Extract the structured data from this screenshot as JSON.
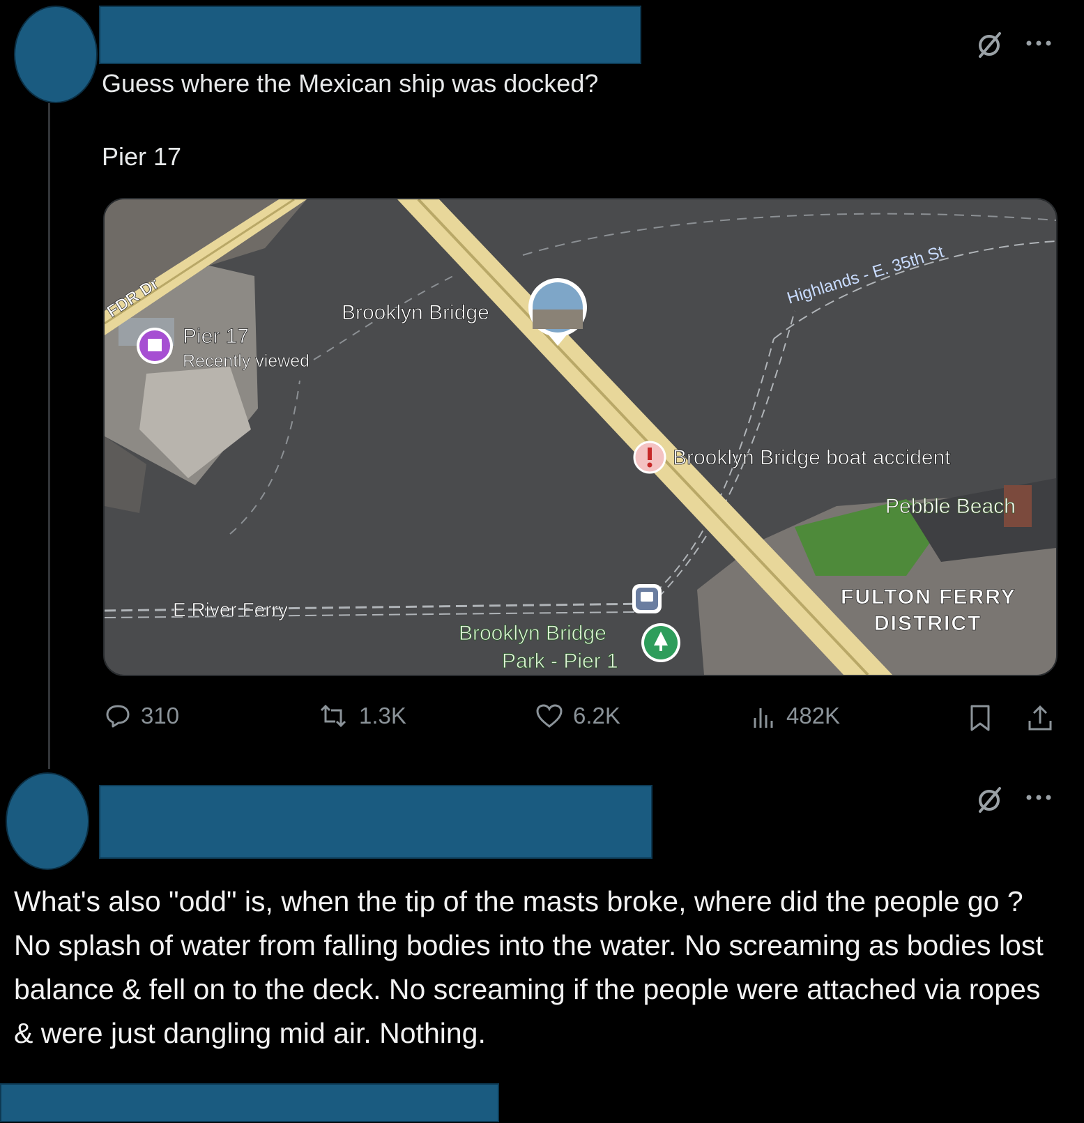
{
  "tweet1": {
    "text_line1": "Guess where the Mexican ship was docked?",
    "text_line2": "Pier 17",
    "menu_icon": "more-horizontal-icon",
    "grok_icon": "grok-slash-icon",
    "map": {
      "labels": {
        "fdr": "FDR Dr",
        "brooklyn_bridge": "Brooklyn Bridge",
        "pier17": "Pier 17",
        "recently_viewed": "Recently viewed",
        "highlands": "Highlands - E. 35th St",
        "accident": "Brooklyn Bridge boat accident",
        "pebble_beach": "Pebble Beach",
        "fulton1": "FULTON FERRY",
        "fulton2": "DISTRICT",
        "e_river_ferry": "E River Ferry",
        "bb_park": "Brooklyn Bridge",
        "bb_park2": "Park - Pier 1"
      },
      "colors": {
        "water": "#4a4b4d",
        "bridge": "#e8d79a",
        "land": "#7a7672",
        "park": "#4e8a3a"
      }
    },
    "actions": {
      "replies": "310",
      "reposts": "1.3K",
      "likes": "6.2K",
      "views": "482K"
    }
  },
  "tweet2": {
    "menu_icon": "more-horizontal-icon",
    "grok_icon": "grok-slash-icon",
    "text": "What's also \"odd\" is, when the tip of the masts broke, where did the people go ? No splash of water from falling bodies into the water. No screaming as bodies lost balance & fell on to the deck. No screaming if the people were attached via ropes & were just dangling mid air. Nothing."
  },
  "colors": {
    "background": "#000000",
    "redaction": "#1a5b80",
    "muted": "#8b9399",
    "text": "#e7e9ea"
  }
}
